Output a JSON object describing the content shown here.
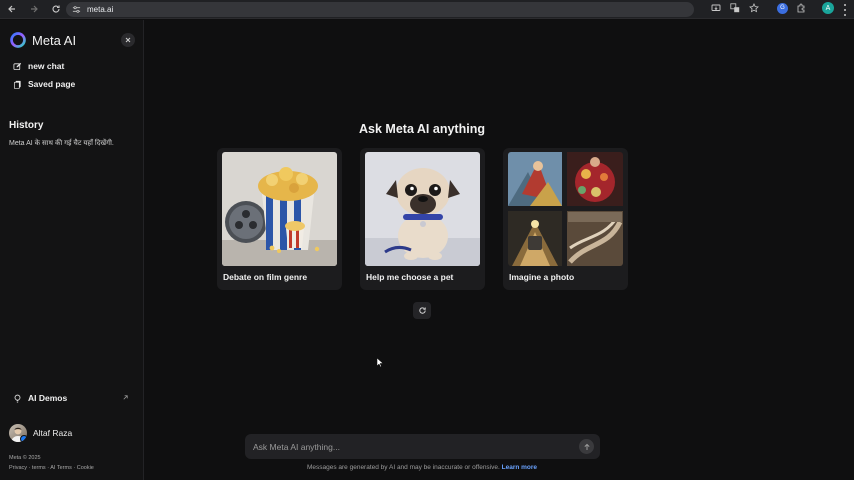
{
  "browser": {
    "url": "meta.ai",
    "profile_initial": "A",
    "extension_initial": "G",
    "icons": [
      "back-arrow-icon",
      "forward-arrow-icon",
      "reload-icon",
      "site-settings-icon",
      "install-app-icon",
      "translate-icon",
      "bookmark-star-icon",
      "extensions-icon",
      "menu-kebab-icon"
    ]
  },
  "sidebar": {
    "brand": "Meta AI",
    "items": [
      {
        "label": "new chat",
        "icon": "edit-icon"
      },
      {
        "label": "Saved page",
        "icon": "saved-page-icon"
      }
    ],
    "history_title": "History",
    "history_empty_text": "Meta AI के साथ की गई चैट यहाँ दिखेंगी.",
    "demos_label": "AI Demos",
    "user_name": "Altaf Raza",
    "copyright": "Meta © 2025",
    "footer_links": "Privacy · terms · AI Terms · Cookie"
  },
  "main": {
    "headline": "Ask Meta AI anything",
    "cards": [
      {
        "label": "Debate on film genre",
        "image": "popcorn-and-film-reel"
      },
      {
        "label": "Help me choose a pet",
        "image": "pug-puppy"
      },
      {
        "label": "Imagine a photo",
        "image": "collage-of-four-photos"
      }
    ],
    "prompt_placeholder": "Ask Meta AI anything...",
    "disclaimer": "Messages are generated by AI and may be inaccurate or offensive.",
    "learn_more": "Learn more"
  },
  "colors": {
    "background": "#0f0f10",
    "sidebar": "#131314",
    "card": "#1c1c1e",
    "link": "#6aa3ff"
  }
}
